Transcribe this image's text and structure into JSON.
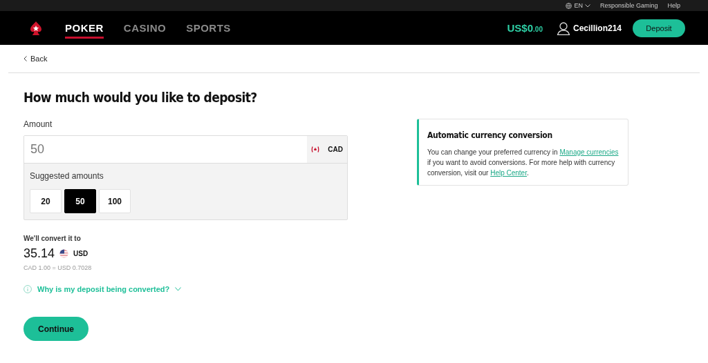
{
  "top_bar": {
    "language": "EN",
    "links": [
      "Responsible Gaming",
      "Help"
    ]
  },
  "nav": {
    "tabs": [
      {
        "label": "POKER",
        "selected": true
      },
      {
        "label": "CASINO",
        "selected": false
      },
      {
        "label": "SPORTS",
        "selected": false
      }
    ],
    "balance": {
      "main": "US$0",
      "cents": ".00"
    },
    "username": "Cecillion214",
    "deposit_button": "Deposit"
  },
  "back_link": "Back",
  "title": "How much would you like to deposit?",
  "amount": {
    "label": "Amount",
    "value": "50",
    "currency": "CAD",
    "suggested_label": "Suggested amounts",
    "suggestions": [
      {
        "label": "20",
        "selected": false
      },
      {
        "label": "50",
        "selected": true
      },
      {
        "label": "100",
        "selected": false
      }
    ]
  },
  "conversion": {
    "label": "We'll convert it to",
    "value": "35.14",
    "currency": "USD",
    "rate": "CAD 1.00 = USD 0.7028",
    "why_link": "Why is my deposit being converted?"
  },
  "continue_button": "Continue",
  "info_card": {
    "title": "Automatic currency conversion",
    "text_parts": [
      {
        "kind": "text",
        "text": "You can change your preferred currency in "
      },
      {
        "kind": "link",
        "text": "Manage currencies"
      },
      {
        "kind": "text",
        "text": " if you want to avoid conversions. For more help with currency conversion, visit our "
      },
      {
        "kind": "link",
        "text": "Help Center"
      },
      {
        "kind": "text",
        "text": "."
      }
    ]
  }
}
